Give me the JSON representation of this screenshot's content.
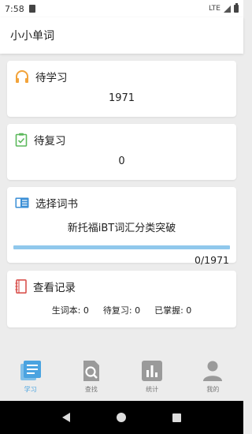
{
  "status_bar": {
    "time": "7:58",
    "network": "LTE"
  },
  "app_bar": {
    "title": "小小单词"
  },
  "cards": {
    "learn": {
      "title": "待学习",
      "value": "1971"
    },
    "review": {
      "title": "待复习",
      "value": "0"
    },
    "book": {
      "title": "选择词书",
      "book_name": "新托福iBT词汇分类突破",
      "progress_text": "0/1971",
      "progress_fraction": 0
    },
    "record": {
      "title": "查看记录",
      "stats": [
        {
          "label": "生词本: 0"
        },
        {
          "label": "待复习: 0"
        },
        {
          "label": "已掌握: 0"
        }
      ]
    }
  },
  "bottom_nav": {
    "items": [
      {
        "label": "学习",
        "icon": "study-icon",
        "active": true
      },
      {
        "label": "查找",
        "icon": "search-icon",
        "active": false
      },
      {
        "label": "统计",
        "icon": "stats-icon",
        "active": false
      },
      {
        "label": "我的",
        "icon": "profile-icon",
        "active": false
      }
    ]
  },
  "colors": {
    "accent_blue": "#4aa3e0",
    "progress": "#90c8ec",
    "headphone_orange": "#f2a33a",
    "clipboard_green": "#5cb85c",
    "notebook_red": "#d9534f",
    "nav_gray": "#9a9a9a"
  }
}
